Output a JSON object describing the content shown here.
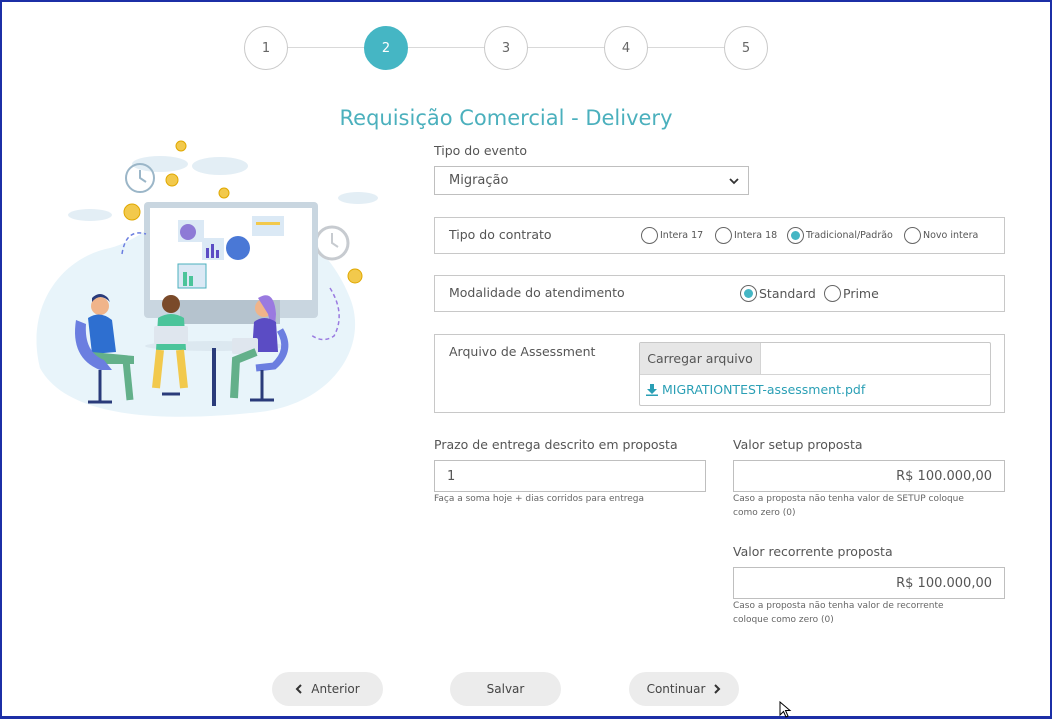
{
  "stepper": {
    "steps": [
      "1",
      "2",
      "3",
      "4",
      "5"
    ],
    "active_index": 1
  },
  "page_title": "Requisição Comercial - Delivery",
  "tipo_evento": {
    "label": "Tipo do evento",
    "selected": "Migração"
  },
  "tipo_contrato": {
    "label": "Tipo do contrato",
    "options": [
      {
        "label": "Intera 17",
        "checked": false
      },
      {
        "label": "Intera 18",
        "checked": false
      },
      {
        "label": "Tradicional/Padrão",
        "checked": true
      },
      {
        "label": "Novo intera",
        "checked": false
      }
    ]
  },
  "modalidade": {
    "label": "Modalidade do atendimento",
    "options": [
      {
        "label": "Standard",
        "checked": true
      },
      {
        "label": "Prime",
        "checked": false
      }
    ]
  },
  "assessment": {
    "label": "Arquivo de Assessment",
    "upload_label": "Carregar arquivo",
    "file_name": "MIGRATIONTEST-assessment.pdf"
  },
  "prazo": {
    "label": "Prazo de entrega descrito em proposta",
    "value": "1",
    "help": "Faça a soma hoje + dias corridos para entrega"
  },
  "setup": {
    "label": "Valor setup proposta",
    "value": "R$ 100.000,00",
    "help_line1": "Caso a proposta não tenha valor de SETUP coloque",
    "help_line2": "como zero (0)"
  },
  "recorrente": {
    "label": "Valor recorrente proposta",
    "value": "R$ 100.000,00",
    "help_line1": "Caso a proposta não tenha valor de recorrente",
    "help_line2": "coloque como zero (0)"
  },
  "actions": {
    "previous": "Anterior",
    "save": "Salvar",
    "next": "Continuar"
  },
  "colors": {
    "accent": "#45b6c4",
    "title": "#4bb0bd",
    "link": "#2a9fb5",
    "frame": "#1c2fa6"
  }
}
